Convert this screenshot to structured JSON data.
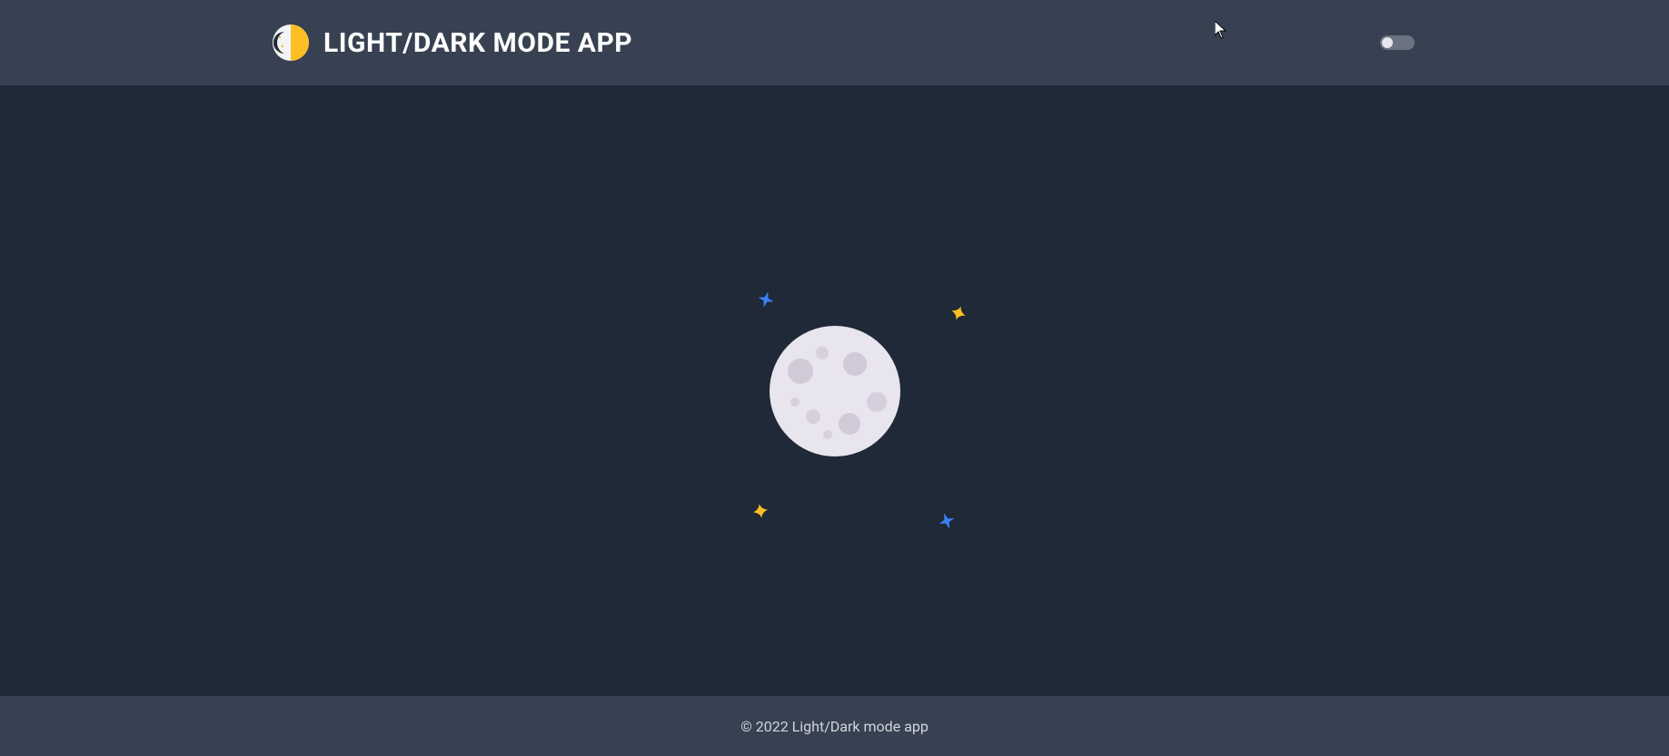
{
  "header": {
    "title": "LIGHT/DARK MODE APP",
    "toggle_state": "off"
  },
  "footer": {
    "copyright": "© 2022 Light/Dark mode app"
  },
  "theme": {
    "mode": "dark",
    "header_bg": "#374151",
    "body_bg": "#1f2937",
    "footer_bg": "#374151",
    "title_color": "#ffffff",
    "footer_text_color": "#d1d5db"
  },
  "illustration": {
    "type": "moon",
    "stars": [
      {
        "color": "blue",
        "position": "top-left"
      },
      {
        "color": "yellow",
        "position": "top-right"
      },
      {
        "color": "yellow",
        "position": "bottom-left"
      },
      {
        "color": "blue",
        "position": "bottom-right"
      }
    ]
  }
}
